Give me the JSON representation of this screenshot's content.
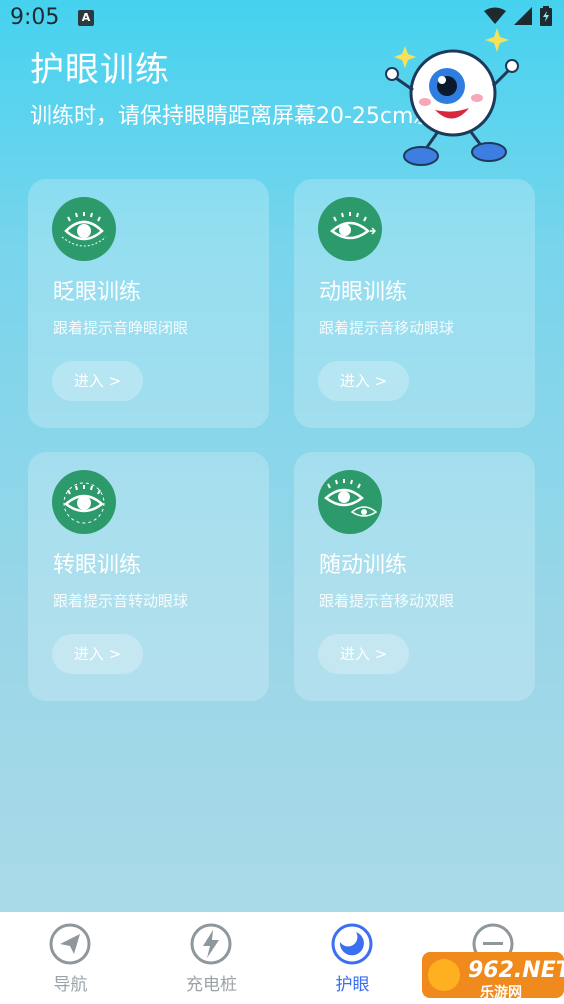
{
  "status_bar": {
    "time": "9:05",
    "badge": "A"
  },
  "header": {
    "title": "护眼训练",
    "subtitle": "训练时，请保持眼睛距离屏幕20-25cm左右"
  },
  "cards": [
    {
      "title": "眨眼训练",
      "desc": "跟着提示音睁眼闭眼",
      "button": "进入 >",
      "icon": "blink-eye-icon"
    },
    {
      "title": "动眼训练",
      "desc": "跟着提示音移动眼球",
      "button": "进入 >",
      "icon": "move-eye-icon"
    },
    {
      "title": "转眼训练",
      "desc": "跟着提示音转动眼球",
      "button": "进入 >",
      "icon": "rotate-eye-icon"
    },
    {
      "title": "随动训练",
      "desc": "跟着提示音移动双眼",
      "button": "进入 >",
      "icon": "follow-eye-icon"
    }
  ],
  "bottom_nav": [
    {
      "label": "导航",
      "icon": "navigation-icon",
      "active": false
    },
    {
      "label": "充电桩",
      "icon": "charging-icon",
      "active": false
    },
    {
      "label": "护眼",
      "icon": "eye-care-icon",
      "active": true
    },
    {
      "label": "",
      "icon": "hourglass-icon",
      "active": false
    }
  ],
  "watermark": {
    "text": "962.NET",
    "sub": "乐游网"
  },
  "colors": {
    "icon_green": "#2c9a6b",
    "active_blue": "#3a6ff0",
    "inactive_gray": "#9aa3a8"
  }
}
